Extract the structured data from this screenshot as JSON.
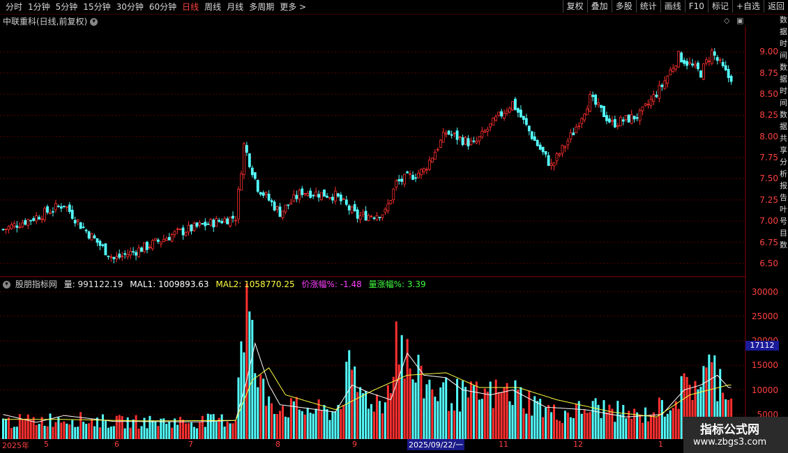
{
  "toolbar": {
    "periods": [
      "分时",
      "1分钟",
      "5分钟",
      "15分钟",
      "30分钟",
      "60分钟",
      "日线",
      "周线",
      "月线",
      "多周期",
      "更多 >"
    ],
    "active": "日线",
    "right": [
      "复权",
      "叠加",
      "多股",
      "统计",
      "画线",
      "F10",
      "标记",
      "+自选",
      "返回"
    ]
  },
  "title": "中联重科(日线,前复权)",
  "indicator": {
    "name": "股朋指标网",
    "vol": "量: 991122.19",
    "mal1": "MAL1: 1009893.63",
    "mal2": "MAL2: 1058770.25",
    "price_chg": "价涨幅%: -1.48",
    "vol_chg": "量涨幅%: 3.39"
  },
  "vol_marker": "17112",
  "dates": {
    "labels": [
      "2025年",
      "5",
      "6",
      "7",
      "8",
      "9",
      "11",
      "12",
      "1"
    ],
    "selected": "2025/09/22/一"
  },
  "right_strip": "数据时间数据时间数据共享分析报告叶号目数",
  "watermark": {
    "title": "指标公式网",
    "url": "www.zbgs3.com"
  },
  "colors": {
    "up": "#ff3030",
    "down": "#54ffff",
    "grid": "#5a0000",
    "ma1": "#ffffff",
    "ma2": "#ffff40"
  },
  "chart_data": [
    {
      "type": "candlestick",
      "title": "中联重科(日线,前复权)",
      "y_ticks": [
        6.5,
        6.75,
        7.0,
        7.25,
        7.5,
        7.75,
        8.0,
        8.25,
        8.5,
        8.75,
        9.0
      ],
      "ylim": [
        6.4,
        9.3
      ],
      "keypoints": [
        {
          "i": 0,
          "v": 6.9
        },
        {
          "i": 12,
          "v": 7.05
        },
        {
          "i": 22,
          "v": 7.2
        },
        {
          "i": 28,
          "v": 6.95
        },
        {
          "i": 40,
          "v": 6.55
        },
        {
          "i": 52,
          "v": 6.7
        },
        {
          "i": 62,
          "v": 6.85
        },
        {
          "i": 72,
          "v": 6.95
        },
        {
          "i": 84,
          "v": 7.05
        },
        {
          "i": 87,
          "v": 7.9
        },
        {
          "i": 92,
          "v": 7.4
        },
        {
          "i": 100,
          "v": 7.1
        },
        {
          "i": 108,
          "v": 7.35
        },
        {
          "i": 120,
          "v": 7.3
        },
        {
          "i": 128,
          "v": 7.05
        },
        {
          "i": 138,
          "v": 7.1
        },
        {
          "i": 142,
          "v": 7.45
        },
        {
          "i": 152,
          "v": 7.6
        },
        {
          "i": 160,
          "v": 8.05
        },
        {
          "i": 170,
          "v": 7.9
        },
        {
          "i": 178,
          "v": 8.2
        },
        {
          "i": 184,
          "v": 8.4
        },
        {
          "i": 192,
          "v": 7.95
        },
        {
          "i": 198,
          "v": 7.65
        },
        {
          "i": 206,
          "v": 8.05
        },
        {
          "i": 212,
          "v": 8.45
        },
        {
          "i": 220,
          "v": 8.15
        },
        {
          "i": 230,
          "v": 8.25
        },
        {
          "i": 238,
          "v": 8.6
        },
        {
          "i": 244,
          "v": 8.95
        },
        {
          "i": 252,
          "v": 8.75
        },
        {
          "i": 256,
          "v": 9.0
        },
        {
          "i": 262,
          "v": 8.7
        }
      ]
    },
    {
      "type": "bar",
      "title": "股朋指标网",
      "y_ticks": [
        5000,
        10000,
        15000,
        20000,
        25000,
        30000
      ],
      "ylim": [
        0,
        31500
      ],
      "series": [
        {
          "name": "量",
          "keypoints": [
            {
              "i": 0,
              "v": 3500
            },
            {
              "i": 12,
              "v": 3800
            },
            {
              "i": 22,
              "v": 4200
            },
            {
              "i": 40,
              "v": 3500
            },
            {
              "i": 70,
              "v": 3600
            },
            {
              "i": 84,
              "v": 4000
            },
            {
              "i": 86,
              "v": 23000
            },
            {
              "i": 88,
              "v": 28000
            },
            {
              "i": 92,
              "v": 11000
            },
            {
              "i": 100,
              "v": 6500
            },
            {
              "i": 120,
              "v": 5500
            },
            {
              "i": 125,
              "v": 13000
            },
            {
              "i": 130,
              "v": 9000
            },
            {
              "i": 138,
              "v": 7000
            },
            {
              "i": 142,
              "v": 22000
            },
            {
              "i": 148,
              "v": 13000
            },
            {
              "i": 158,
              "v": 9500
            },
            {
              "i": 168,
              "v": 8500
            },
            {
              "i": 184,
              "v": 9500
            },
            {
              "i": 200,
              "v": 5000
            },
            {
              "i": 215,
              "v": 6500
            },
            {
              "i": 230,
              "v": 4500
            },
            {
              "i": 240,
              "v": 7000
            },
            {
              "i": 248,
              "v": 11000
            },
            {
              "i": 256,
              "v": 14000
            },
            {
              "i": 262,
              "v": 10500
            }
          ]
        },
        {
          "name": "MAL1",
          "keypoints": [
            {
              "i": 0,
              "v": 5000
            },
            {
              "i": 12,
              "v": 3400
            },
            {
              "i": 22,
              "v": 4800
            },
            {
              "i": 40,
              "v": 3600
            },
            {
              "i": 70,
              "v": 3500
            },
            {
              "i": 84,
              "v": 3800
            },
            {
              "i": 88,
              "v": 12000
            },
            {
              "i": 91,
              "v": 19500
            },
            {
              "i": 96,
              "v": 11000
            },
            {
              "i": 100,
              "v": 7000
            },
            {
              "i": 120,
              "v": 5500
            },
            {
              "i": 126,
              "v": 11000
            },
            {
              "i": 132,
              "v": 9500
            },
            {
              "i": 140,
              "v": 8000
            },
            {
              "i": 146,
              "v": 17500
            },
            {
              "i": 152,
              "v": 13000
            },
            {
              "i": 160,
              "v": 12500
            },
            {
              "i": 166,
              "v": 10000
            },
            {
              "i": 176,
              "v": 9000
            },
            {
              "i": 184,
              "v": 10000
            },
            {
              "i": 196,
              "v": 6500
            },
            {
              "i": 210,
              "v": 6000
            },
            {
              "i": 225,
              "v": 4500
            },
            {
              "i": 238,
              "v": 5000
            },
            {
              "i": 246,
              "v": 10000
            },
            {
              "i": 252,
              "v": 11000
            },
            {
              "i": 258,
              "v": 13000
            },
            {
              "i": 262,
              "v": 10500
            }
          ]
        },
        {
          "name": "MAL2",
          "keypoints": [
            {
              "i": 0,
              "v": 4000
            },
            {
              "i": 22,
              "v": 4000
            },
            {
              "i": 50,
              "v": 3700
            },
            {
              "i": 84,
              "v": 3800
            },
            {
              "i": 90,
              "v": 12000
            },
            {
              "i": 96,
              "v": 14500
            },
            {
              "i": 102,
              "v": 9000
            },
            {
              "i": 120,
              "v": 6000
            },
            {
              "i": 134,
              "v": 10000
            },
            {
              "i": 146,
              "v": 13000
            },
            {
              "i": 160,
              "v": 13500
            },
            {
              "i": 172,
              "v": 10500
            },
            {
              "i": 186,
              "v": 10500
            },
            {
              "i": 200,
              "v": 8000
            },
            {
              "i": 220,
              "v": 5500
            },
            {
              "i": 236,
              "v": 4500
            },
            {
              "i": 248,
              "v": 9000
            },
            {
              "i": 262,
              "v": 11000
            }
          ]
        }
      ]
    }
  ]
}
